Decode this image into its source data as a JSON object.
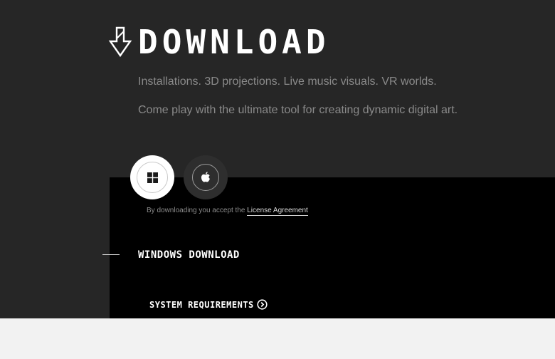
{
  "header": {
    "title": "DOWNLOAD",
    "title_icon": "download-arrow-icon"
  },
  "taglines": [
    "Installations. 3D projections. Live music visuals. VR worlds.",
    "Come play with the ultimate tool for creating dynamic digital art."
  ],
  "os_buttons": [
    {
      "name": "windows",
      "icon": "windows-icon",
      "selected": true
    },
    {
      "name": "mac",
      "icon": "apple-icon",
      "selected": false
    }
  ],
  "license": {
    "prefix": "By downloading you accept the ",
    "link_label": "License Agreement"
  },
  "download": {
    "heading": "WINDOWS DOWNLOAD",
    "system_requirements_label": "SYSTEM REQUIREMENTS",
    "system_requirements_icon": "chevron-right-circle-icon"
  },
  "colors": {
    "page_background": "#262626",
    "panel_background": "#000000",
    "footer_background": "#f2f2f2",
    "tagline_text": "#8a8a8a",
    "title_text": "#ffffff"
  }
}
